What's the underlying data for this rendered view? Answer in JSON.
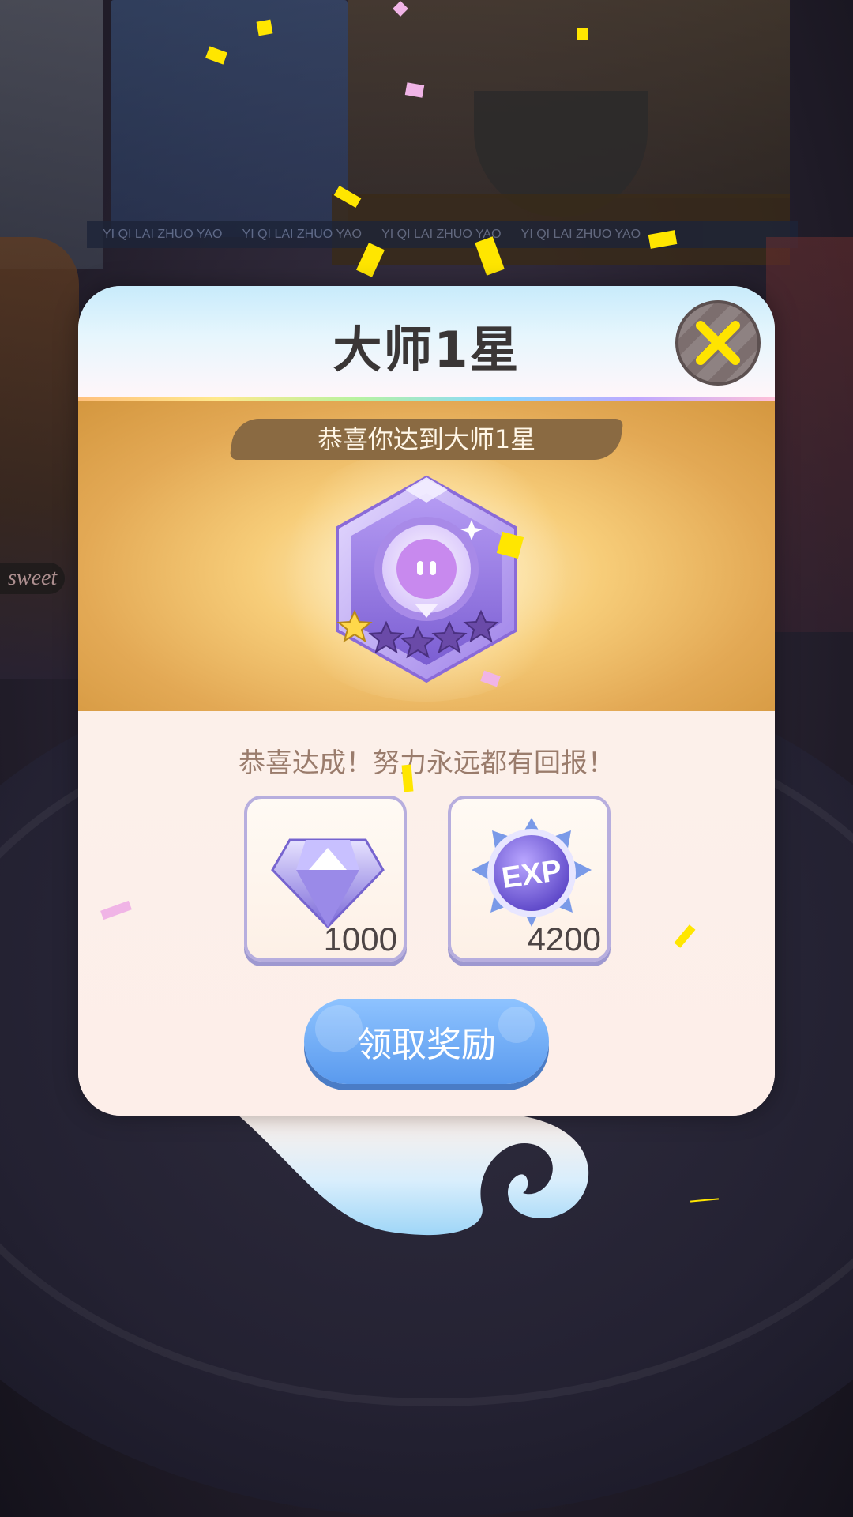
{
  "dialog": {
    "title": "大师1星",
    "ribbon": "恭喜你达到大师1星",
    "congrats": "恭喜达成！努力永远都有回报！",
    "claim_label": "领取奖励"
  },
  "badge": {
    "rank": "大师",
    "stars_total": 5,
    "stars_filled": 1,
    "colors": {
      "primary": "#9b7be6",
      "star_filled": "#ffd84a",
      "star_empty": "#6a4aa8"
    }
  },
  "rewards": [
    {
      "kind": "diamond",
      "icon": "diamond-icon",
      "quantity": "1000"
    },
    {
      "kind": "exp",
      "icon": "exp-icon",
      "label": "EXP",
      "quantity": "4200"
    }
  ],
  "background": {
    "sign_text": "YI QI LAI ZHUO YAO",
    "shop_text": "sweet"
  },
  "colors": {
    "title": "#3a3636",
    "claim_button": "#6aa6f2",
    "reward_border": "#b7aede"
  }
}
